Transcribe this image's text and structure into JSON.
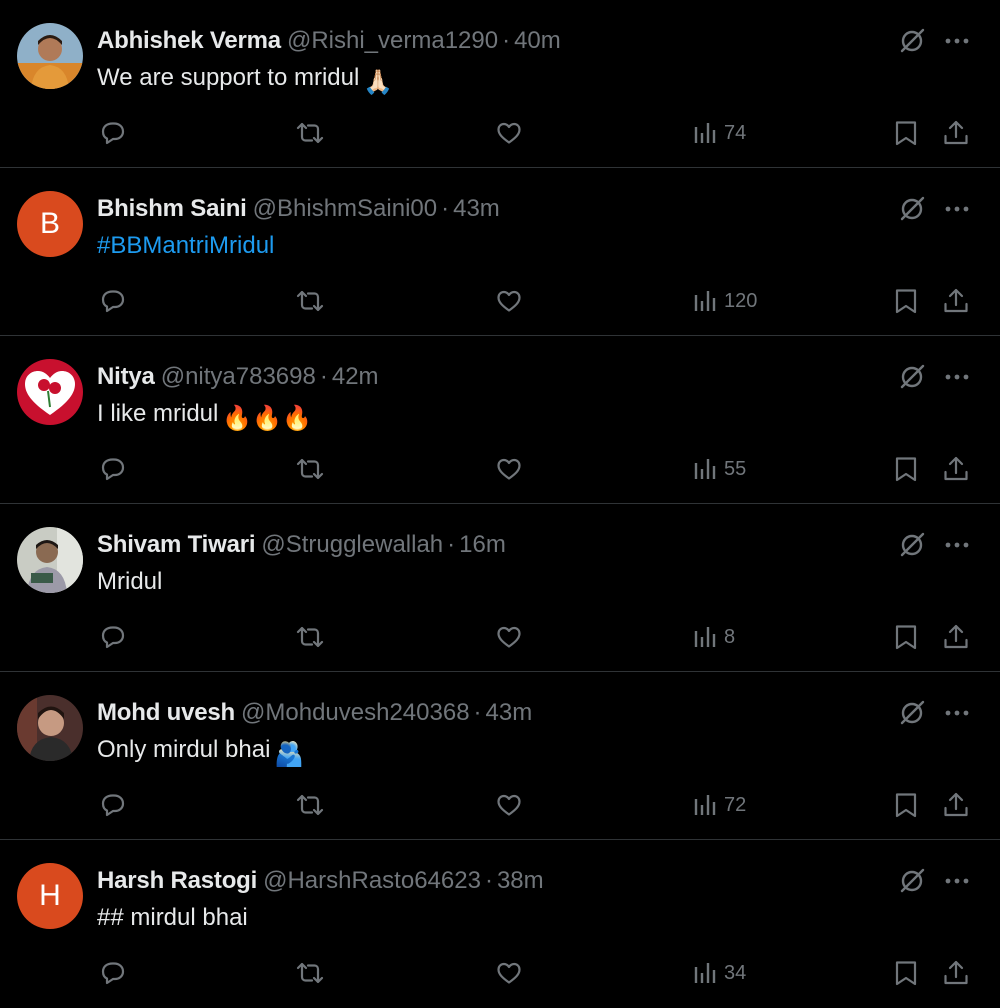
{
  "icons": {
    "reply": "reply-icon",
    "retweet": "retweet-icon",
    "like": "like-icon",
    "views": "views-icon",
    "bookmark": "bookmark-icon",
    "share": "share-icon",
    "grok": "grok-icon",
    "more": "more-icon"
  },
  "colors": {
    "background": "#000000",
    "text": "#e7e9ea",
    "muted": "#71767b",
    "link": "#1d9bf0",
    "letter_avatar": "#d94a1e",
    "divider": "#2f3336"
  },
  "tweets": [
    {
      "name": "Abhishek Verma",
      "handle": "@Rishi_verma1290",
      "sep": "·",
      "time": "40m",
      "text": "We are support to mridul",
      "emoji": "🙏🏻",
      "views": "74"
    },
    {
      "name": "Bhishm Saini",
      "handle": "@BhishmSaini00",
      "sep": "·",
      "time": "43m",
      "avatar_letter": "B",
      "text": "#BBMantriMridul",
      "views": "120"
    },
    {
      "name": "Nitya",
      "handle": "@nitya783698",
      "sep": "·",
      "time": "42m",
      "text": "I like mridul",
      "emoji": "🔥🔥🔥",
      "views": "55"
    },
    {
      "name": "Shivam Tiwari",
      "handle": "@Strugglewallah",
      "sep": "·",
      "time": "16m",
      "text": "Mridul",
      "views": "8"
    },
    {
      "name": "Mohd uvesh",
      "handle": "@Mohduvesh240368",
      "sep": "·",
      "time": "43m",
      "text": "Only mirdul bhai",
      "emoji": "🫂",
      "views": "72"
    },
    {
      "name": "Harsh Rastogi",
      "handle": "@HarshRasto64623",
      "sep": "·",
      "time": "38m",
      "avatar_letter": "H",
      "text": "## mirdul bhai",
      "views": "34"
    }
  ]
}
